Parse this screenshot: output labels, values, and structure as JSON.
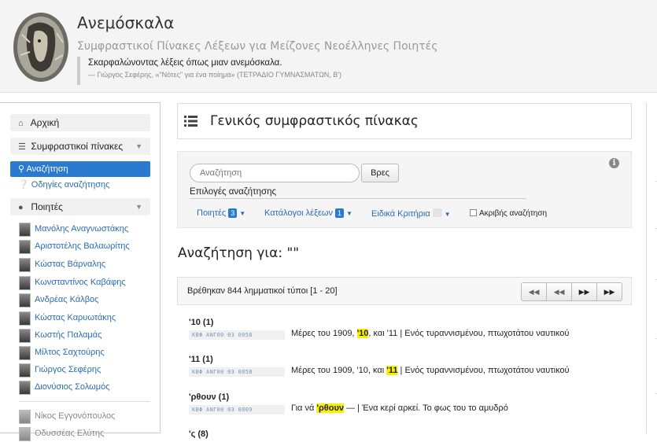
{
  "header": {
    "title": "Ανεμόσκαλα",
    "subtitle": "Συμφραστικοί Πίνακες Λέξεων για Μείζονες Νεοέλληνες Ποιητές",
    "quote": "Σκαρφαλώνοντας λέξεις όπως μιαν ανεμόσκαλα.",
    "quote_source": "— Γιώργος Σεφέρης, «\"Νότες\" για ένα ποίημα» (ΤΕΤΡΑΔΙΟ ΓΥΜΝΑΣΜΑΤΩΝ, Β')"
  },
  "sidebar": {
    "home": "Αρχική",
    "concordances": "Συμφραστικοί πίνακες",
    "search": "Αναζήτηση",
    "help": "Οδηγίες αναζήτησης",
    "poets_label": "Ποιητές",
    "poets": [
      "Μανόλης Αναγνωστάκης",
      "Αριστοτέλης Βαλαωρίτης",
      "Κώστας Βάρναλης",
      "Κωνσταντίνος Καβάφης",
      "Ανδρέας Κάλβος",
      "Κώστας Καρυωτάκης",
      "Κωστής Παλαμάς",
      "Μίλτος Σαχτούρης",
      "Γιώργος Σεφέρης",
      "Διονύσιος Σολωμός"
    ],
    "other_poets": [
      "Νίκος Εγγονόπουλος",
      "Οδυσσέας Ελύτης"
    ]
  },
  "main": {
    "page_title": "Γενικός συμφραστικός πίνακας",
    "search_placeholder": "Αναζήτηση",
    "search_button": "Βρες",
    "options_label": "Επιλογές αναζήτησης",
    "opt_poets": "Ποιητές",
    "opt_poets_count": "3",
    "opt_catalogs": "Κατάλογοι λέξεων",
    "opt_catalogs_count": "1",
    "opt_criteria": "Ειδικά Κριτήρια",
    "opt_exact": "Ακριβής αναζήτηση",
    "search_heading": "Αναζήτηση για: \"\"",
    "results_count": "Βρέθηκαν 844 λημματικοί τύποι [1 - 20]"
  },
  "pager": {
    "icons": [
      "first-page-icon",
      "prev-page-icon",
      "next-page-icon",
      "last-page-icon"
    ]
  },
  "results": [
    {
      "word": "'10 (1)",
      "ref": "ΚΒΦ ΑΝΓ00 03 0058",
      "before": "Μέρες του 1909, ",
      "hit": "'10",
      "after": ", και '11 | Ενός τυραννισμένου, πτωχοτάτου ναυτικού"
    },
    {
      "word": "'11 (1)",
      "ref": "ΚΒΦ ΑΝΓ00 03 0058",
      "before": "Μέρες του 1909, '10, και ",
      "hit": "'11",
      "after": " | Ενός τυραννισμένου, πτωχοτάτου ναυτικού"
    },
    {
      "word": "'ρθουν (1)",
      "ref": "ΚΒΦ ΑΝΓ00 03 0009",
      "before": "Για νά ",
      "hit": "'ρθουν",
      "after": " — | Ένα κερί αρκεί. Το φως του το αμυδρό"
    },
    {
      "word": "'ς (8)",
      "ref": "",
      "before": "",
      "hit": "",
      "after": ""
    }
  ],
  "colors": {
    "accent": "#2a7bd0",
    "link": "#2a6bb3",
    "highlight": "#f7f000"
  }
}
